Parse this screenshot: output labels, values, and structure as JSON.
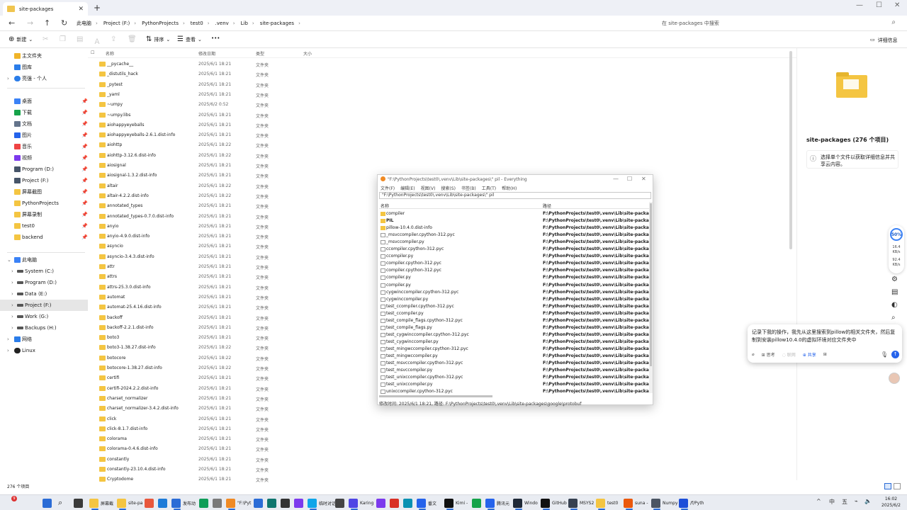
{
  "window": {
    "tab_title": "site-packages",
    "new_tab": "+",
    "close": "✕",
    "min": "—",
    "max": "☐",
    "close_win": "✕"
  },
  "nav": {
    "back": "←",
    "forward": "→",
    "up": "↑",
    "refresh": "↻",
    "monitor": "🖵"
  },
  "breadcrumb": [
    "此电脑",
    "Project (F:)",
    "PythonProjects",
    "test0",
    ".venv",
    "Lib",
    "site-packages"
  ],
  "search": {
    "placeholder": "在 site-packages 中搜索"
  },
  "toolbar": {
    "new": "新建",
    "sort": "排序",
    "view": "查看",
    "more": "•••",
    "details": "详细信息"
  },
  "sidebar": {
    "top": [
      {
        "label": "主文件夹",
        "color": "#f0b429"
      },
      {
        "label": "图库",
        "color": "#2b7de9"
      },
      {
        "label": "亮强 - 个人",
        "color": "#2b7de9"
      }
    ],
    "quick": [
      {
        "label": "桌面",
        "color": "#3b82f6"
      },
      {
        "label": "下载",
        "color": "#16a34a"
      },
      {
        "label": "文档",
        "color": "#64748b"
      },
      {
        "label": "图片",
        "color": "#2563eb"
      },
      {
        "label": "音乐",
        "color": "#ef4444"
      },
      {
        "label": "视频",
        "color": "#7c3aed"
      },
      {
        "label": "Program (D:)",
        "color": "#475569"
      },
      {
        "label": "Project (F:)",
        "color": "#475569"
      },
      {
        "label": "屏幕截图",
        "color": "#f4c542"
      },
      {
        "label": "PythonProjects",
        "color": "#f4c542"
      },
      {
        "label": "屏幕录制",
        "color": "#f4c542"
      },
      {
        "label": "test0",
        "color": "#f4c542"
      },
      {
        "label": "backend",
        "color": "#f4c542"
      }
    ],
    "pc": {
      "label": "此电脑",
      "color": "#3b82f6"
    },
    "drives": [
      {
        "label": "System (C:)"
      },
      {
        "label": "Program (D:)"
      },
      {
        "label": "Data (E:)"
      },
      {
        "label": "Project (F:)"
      },
      {
        "label": "Work (G:)"
      },
      {
        "label": "Backups (H:)"
      }
    ],
    "network": {
      "label": "网络"
    },
    "linux": {
      "label": "Linux"
    },
    "pin": "📌"
  },
  "columns": {
    "name": "名称",
    "date": "修改日期",
    "type": "类型",
    "size": "大小"
  },
  "files": [
    {
      "name": "__pycache__",
      "date": "2025/6/1 18:21",
      "type": "文件夹"
    },
    {
      "name": "_distutils_hack",
      "date": "2025/6/1 18:21",
      "type": "文件夹"
    },
    {
      "name": "_pytest",
      "date": "2025/6/1 18:21",
      "type": "文件夹"
    },
    {
      "name": "_yaml",
      "date": "2025/6/1 18:21",
      "type": "文件夹"
    },
    {
      "name": "~umpy",
      "date": "2025/6/2 0:52",
      "type": "文件夹"
    },
    {
      "name": "~umpy.libs",
      "date": "2025/6/1 18:21",
      "type": "文件夹"
    },
    {
      "name": "aiohappyeyeballs",
      "date": "2025/6/1 18:21",
      "type": "文件夹"
    },
    {
      "name": "aiohappyeyeballs-2.6.1.dist-info",
      "date": "2025/6/1 18:21",
      "type": "文件夹"
    },
    {
      "name": "aiohttp",
      "date": "2025/6/1 18:22",
      "type": "文件夹"
    },
    {
      "name": "aiohttp-3.12.6.dist-info",
      "date": "2025/6/1 18:22",
      "type": "文件夹"
    },
    {
      "name": "aiosignal",
      "date": "2025/6/1 18:21",
      "type": "文件夹"
    },
    {
      "name": "aiosignal-1.3.2.dist-info",
      "date": "2025/6/1 18:21",
      "type": "文件夹"
    },
    {
      "name": "altair",
      "date": "2025/6/1 18:22",
      "type": "文件夹"
    },
    {
      "name": "altair-4.2.2.dist-info",
      "date": "2025/6/1 18:22",
      "type": "文件夹"
    },
    {
      "name": "annotated_types",
      "date": "2025/6/1 18:21",
      "type": "文件夹"
    },
    {
      "name": "annotated_types-0.7.0.dist-info",
      "date": "2025/6/1 18:21",
      "type": "文件夹"
    },
    {
      "name": "anyio",
      "date": "2025/6/1 18:21",
      "type": "文件夹"
    },
    {
      "name": "anyio-4.9.0.dist-info",
      "date": "2025/6/1 18:21",
      "type": "文件夹"
    },
    {
      "name": "asyncio",
      "date": "2025/6/1 18:21",
      "type": "文件夹"
    },
    {
      "name": "asyncio-3.4.3.dist-info",
      "date": "2025/6/1 18:21",
      "type": "文件夹"
    },
    {
      "name": "attr",
      "date": "2025/6/1 18:21",
      "type": "文件夹"
    },
    {
      "name": "attrs",
      "date": "2025/6/1 18:21",
      "type": "文件夹"
    },
    {
      "name": "attrs-25.3.0.dist-info",
      "date": "2025/6/1 18:21",
      "type": "文件夹"
    },
    {
      "name": "automat",
      "date": "2025/6/1 18:21",
      "type": "文件夹"
    },
    {
      "name": "automat-25.4.16.dist-info",
      "date": "2025/6/1 18:21",
      "type": "文件夹"
    },
    {
      "name": "backoff",
      "date": "2025/6/1 18:21",
      "type": "文件夹"
    },
    {
      "name": "backoff-2.2.1.dist-info",
      "date": "2025/6/1 18:21",
      "type": "文件夹"
    },
    {
      "name": "boto3",
      "date": "2025/6/1 18:21",
      "type": "文件夹"
    },
    {
      "name": "boto3-1.38.27.dist-info",
      "date": "2025/6/1 18:22",
      "type": "文件夹"
    },
    {
      "name": "botocore",
      "date": "2025/6/1 18:22",
      "type": "文件夹"
    },
    {
      "name": "botocore-1.38.27.dist-info",
      "date": "2025/6/1 18:22",
      "type": "文件夹"
    },
    {
      "name": "certifi",
      "date": "2025/6/1 18:21",
      "type": "文件夹"
    },
    {
      "name": "certifi-2024.2.2.dist-info",
      "date": "2025/6/1 18:21",
      "type": "文件夹"
    },
    {
      "name": "charset_normalizer",
      "date": "2025/6/1 18:21",
      "type": "文件夹"
    },
    {
      "name": "charset_normalizer-3.4.2.dist-info",
      "date": "2025/6/1 18:21",
      "type": "文件夹"
    },
    {
      "name": "click",
      "date": "2025/6/1 18:21",
      "type": "文件夹"
    },
    {
      "name": "click-8.1.7.dist-info",
      "date": "2025/6/1 18:21",
      "type": "文件夹"
    },
    {
      "name": "colorama",
      "date": "2025/6/1 18:21",
      "type": "文件夹"
    },
    {
      "name": "colorama-0.4.6.dist-info",
      "date": "2025/6/1 18:21",
      "type": "文件夹"
    },
    {
      "name": "constantly",
      "date": "2025/6/1 18:21",
      "type": "文件夹"
    },
    {
      "name": "constantly-23.10.4.dist-info",
      "date": "2025/6/1 18:21",
      "type": "文件夹"
    },
    {
      "name": "Cryptodome",
      "date": "2025/6/1 18:21",
      "type": "文件夹"
    }
  ],
  "status": {
    "count": "276 个项目"
  },
  "details": {
    "title": "site-packages (276 个项目)",
    "info": "选择单个文件以获取详细信息并共享云内容。"
  },
  "everything": {
    "title": "\"F:\\PythonProjects\\test0\\.venv\\Lib\\site-packages\\\" pil - Everything",
    "menu": [
      "文件(F)",
      "编辑(E)",
      "视图(V)",
      "搜索(S)",
      "书签(B)",
      "工具(T)",
      "帮助(H)"
    ],
    "query": "\"F:\\PythonProjects\\test0\\.venv\\Lib\\site-packages\\\" pil",
    "col_name": "名称",
    "col_path": "路径",
    "path": "F:\\PythonProjects\\test0\\.venv\\Lib\\site-packages\\",
    "rows": [
      {
        "name": "compiler",
        "kind": "folder"
      },
      {
        "name": "PIL",
        "kind": "folder"
      },
      {
        "name": "pillow-10.4.0.dist-info",
        "kind": "folder"
      },
      {
        "name": "_msvccompiler.cpython-312.pyc",
        "kind": "file"
      },
      {
        "name": "_msvccompiler.py",
        "kind": "file"
      },
      {
        "name": "ccompiler.cpython-312.pyc",
        "kind": "file"
      },
      {
        "name": "ccompiler.py",
        "kind": "file"
      },
      {
        "name": "compiler.cpython-312.pyc",
        "kind": "file"
      },
      {
        "name": "compiler.cpython-312.pyc",
        "kind": "file"
      },
      {
        "name": "compiler.py",
        "kind": "file"
      },
      {
        "name": "compiler.py",
        "kind": "file"
      },
      {
        "name": "cygwinccompiler.cpython-312.pyc",
        "kind": "file"
      },
      {
        "name": "cygwinccompiler.py",
        "kind": "file"
      },
      {
        "name": "test_ccompiler.cpython-312.pyc",
        "kind": "file"
      },
      {
        "name": "test_ccompiler.py",
        "kind": "file"
      },
      {
        "name": "test_compile_flags.cpython-312.pyc",
        "kind": "file"
      },
      {
        "name": "test_compile_flags.py",
        "kind": "file"
      },
      {
        "name": "test_cygwinccompiler.cpython-312.pyc",
        "kind": "file"
      },
      {
        "name": "test_cygwinccompiler.py",
        "kind": "file"
      },
      {
        "name": "test_mingwccompiler.cpython-312.pyc",
        "kind": "file"
      },
      {
        "name": "test_mingwccompiler.py",
        "kind": "file"
      },
      {
        "name": "test_msvccompiler.cpython-312.pyc",
        "kind": "file"
      },
      {
        "name": "test_msvccompiler.py",
        "kind": "file"
      },
      {
        "name": "test_unixccompiler.cpython-312.pyc",
        "kind": "file"
      },
      {
        "name": "test_unixccompiler.py",
        "kind": "file"
      },
      {
        "name": "unixccompiler.cpython-312.pyc",
        "kind": "file"
      }
    ],
    "status": "修改时间: 2025/6/1 18:21, 路径: F:\\PythonProjects\\test0\\.venv\\Lib\\site-packages\\google\\protobuf"
  },
  "perf": {
    "percent": "50%",
    "up": "16.4",
    "up_unit": "KB/s",
    "down": "92.4",
    "down_unit": "KB/s"
  },
  "chat": {
    "text": "记录下我的操作，我先从这里搜索到pillow的相关文件夹，然后复制到安装pillow10.4.0的虚拟环境对应文件夹中",
    "think": "思考",
    "search": "联网",
    "share": "共享",
    "send": "↑"
  },
  "taskbar": {
    "apps": [
      "屏幕截",
      "site-pa",
      "",
      "",
      "发布动",
      "",
      "",
      "\"F:\\Pyt",
      "",
      "",
      "",
      "",
      "临时对话",
      "",
      "Karing",
      "",
      "",
      "",
      "番文",
      "Kimi -",
      "",
      "腾讯元",
      "Windo",
      "GitHub",
      "MSYS2",
      "test0",
      "suna -",
      "Numpy",
      "/f/Pyth"
    ],
    "tray": [
      "^",
      "中",
      "五"
    ],
    "time": "16:02",
    "date": "2025/6/2",
    "badge": "9"
  }
}
